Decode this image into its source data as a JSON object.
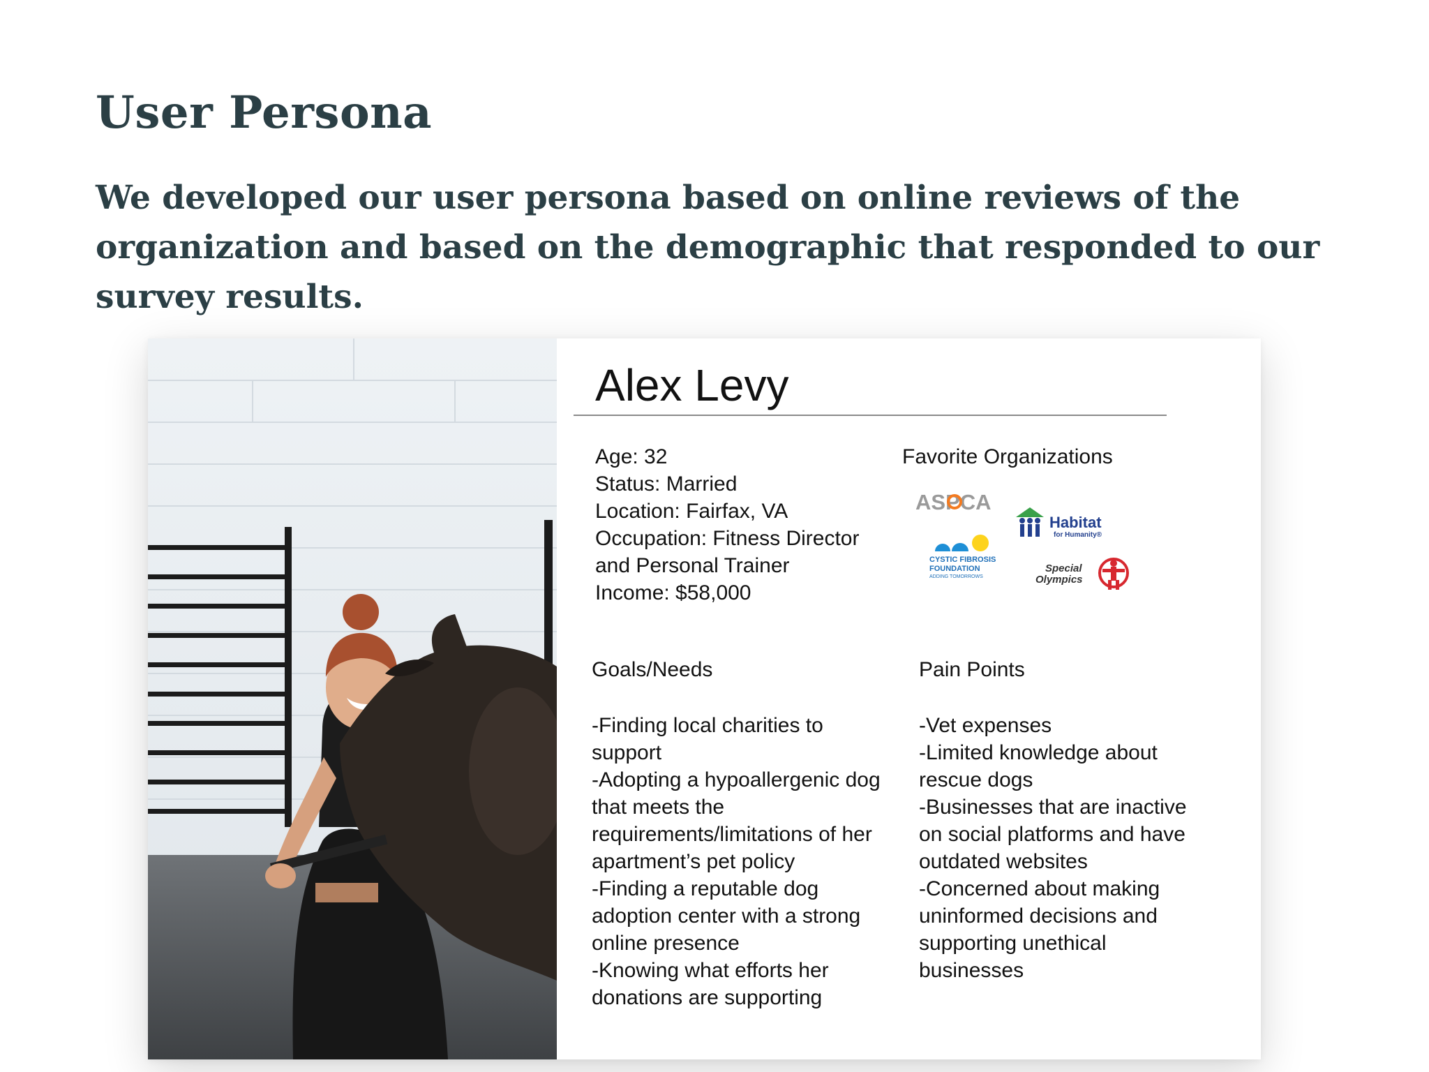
{
  "page": {
    "title": "User Persona",
    "subtitle": "We developed our user persona based on online reviews of the organization and based on the demographic that responded to our survey results."
  },
  "persona": {
    "name": "Alex Levy",
    "details": [
      "Age: 32",
      "Status: Married",
      "Location: Fairfax, VA",
      "Occupation: Fitness Director",
      "and Personal Trainer",
      "Income: $58,000"
    ],
    "favorite_label": "Favorite Organizations",
    "organizations": {
      "aspca": "ASPCA",
      "habitat_main": "Habitat",
      "habitat_sub": "for Humanity®",
      "cf_line1": "CYSTIC FIBROSIS",
      "cf_line2": "FOUNDATION",
      "cf_line3": "ADDING TOMORROWS",
      "special_line1": "Special",
      "special_line2": "Olympics"
    },
    "goals_heading": "Goals/Needs",
    "goals": [
      "-Finding local charities to support",
      "-Adopting a hypoallergenic dog that meets the requirements/limitations of her apartment’s pet policy",
      "-Finding a reputable dog adoption center with a strong online presence",
      "-Knowing what efforts her donations are supporting"
    ],
    "pains_heading": "Pain Points",
    "pains": [
      "-Vet expenses",
      "-Limited knowledge about rescue dogs",
      "-Businesses that are inactive on social platforms and have outdated websites",
      "-Concerned about making uninformed decisions and supporting unethical businesses"
    ]
  },
  "colors": {
    "heading": "#2b3f45",
    "aspca_gray": "#9a9a9a",
    "aspca_orange": "#f47b20",
    "habitat_green": "#3aa14a",
    "habitat_blue": "#23408e",
    "cf_blue": "#1e8fd6",
    "special_red": "#d7282f"
  },
  "icons": {
    "photo": "woman-playing-with-dog-photo"
  }
}
